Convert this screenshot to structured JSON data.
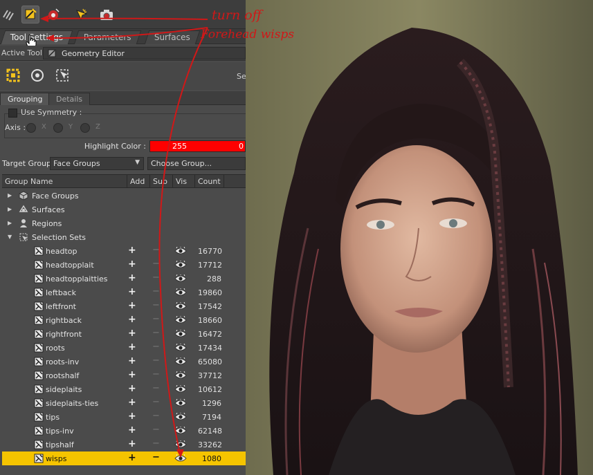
{
  "tabs": [
    {
      "label": "Tool Settings",
      "active": true
    },
    {
      "label": "Parameters",
      "active": false
    },
    {
      "label": "Surfaces",
      "active": false
    }
  ],
  "active_tool": {
    "label": "Active Tool :",
    "value": "Geometry Editor"
  },
  "tool_strip": {
    "truncated_label": "Se"
  },
  "subtabs": [
    {
      "label": "Grouping",
      "active": true
    },
    {
      "label": "Details",
      "active": false
    }
  ],
  "symmetry": {
    "label": "Use Symmetry :",
    "checked": false
  },
  "axis": {
    "label": "Axis :",
    "options": [
      "X",
      "Y",
      "Z"
    ]
  },
  "highlight": {
    "label": "Highlight Color :",
    "r": "255",
    "g": "0",
    "color": "#ff0000"
  },
  "target_group": {
    "label": "Target Group :",
    "value": "Face Groups",
    "choose": "Choose Group..."
  },
  "columns": [
    "Group Name",
    "Add",
    "Sub",
    "Vis",
    "Count"
  ],
  "tree_groups": [
    {
      "label": "Face Groups",
      "icon": "cube-icon",
      "expanded": false
    },
    {
      "label": "Surfaces",
      "icon": "surfaces-icon",
      "expanded": false
    },
    {
      "label": "Regions",
      "icon": "person-icon",
      "expanded": false
    },
    {
      "label": "Selection Sets",
      "icon": "selection-sets-icon",
      "expanded": true
    }
  ],
  "selection_sets": [
    {
      "name": "headtop",
      "count": "16770"
    },
    {
      "name": "headtopplait",
      "count": "17712"
    },
    {
      "name": "headtopplaitties",
      "count": "288"
    },
    {
      "name": "leftback",
      "count": "19860"
    },
    {
      "name": "leftfront",
      "count": "17542"
    },
    {
      "name": "rightback",
      "count": "18660"
    },
    {
      "name": "rightfront",
      "count": "16472"
    },
    {
      "name": "roots",
      "count": "17434"
    },
    {
      "name": "roots-inv",
      "count": "65080"
    },
    {
      "name": "rootshalf",
      "count": "37712"
    },
    {
      "name": "sideplaits",
      "count": "10612"
    },
    {
      "name": "sideplaits-ties",
      "count": "1296"
    },
    {
      "name": "tips",
      "count": "7194"
    },
    {
      "name": "tips-inv",
      "count": "62148"
    },
    {
      "name": "tipshalf",
      "count": "33262"
    },
    {
      "name": "wisps",
      "count": "1080",
      "selected": true
    }
  ],
  "symbols": {
    "add": "+",
    "sub": "−"
  },
  "annotation": {
    "line1": "turn off",
    "line2": "Forehead wisps",
    "color": "#d01818"
  },
  "colors": {
    "accent": "#f5c400",
    "highlight": "#ff0000"
  }
}
